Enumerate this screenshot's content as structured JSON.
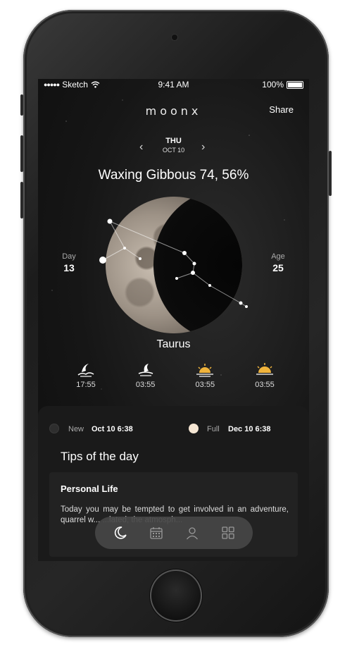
{
  "status_bar": {
    "carrier": "Sketch",
    "time": "9:41 AM",
    "battery": "100%"
  },
  "header": {
    "logo": "moonx",
    "share_label": "Share"
  },
  "date_nav": {
    "day": "THU",
    "date": "OCT 10"
  },
  "phase_title": "Waxing Gibbous 74, 56%",
  "moon_stats": {
    "day_label": "Day",
    "day_value": "13",
    "age_label": "Age",
    "age_value": "25"
  },
  "zodiac_sign": "Taurus",
  "times": [
    {
      "icon": "moonrise-icon",
      "value": "17:55"
    },
    {
      "icon": "moonset-icon",
      "value": "03:55"
    },
    {
      "icon": "sunrise-icon",
      "value": "03:55"
    },
    {
      "icon": "sunset-icon",
      "value": "03:55"
    }
  ],
  "phases": {
    "new_label": "New",
    "new_date": "Oct 10 6:38",
    "full_label": "Full",
    "full_date": "Dec 10 6:38"
  },
  "tips": {
    "title": "Tips of the day",
    "card_heading": "Personal Life",
    "card_body": "Today you may be tempted to get involved in an adventure, quarrel w... ...lated, the atmosph..."
  },
  "tab_bar": [
    {
      "icon": "moon-icon",
      "active": true
    },
    {
      "icon": "calendar-icon",
      "active": false
    },
    {
      "icon": "profile-icon",
      "active": false
    },
    {
      "icon": "grid-icon",
      "active": false
    }
  ],
  "colors": {
    "accent_sun": "#f0b43c",
    "full_moon_dot": "#f5e6d3",
    "screen_bg": "#161616"
  }
}
